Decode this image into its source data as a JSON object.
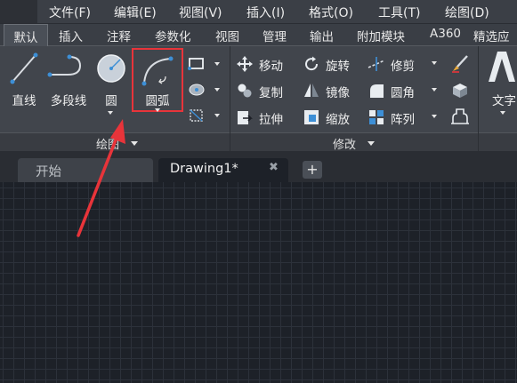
{
  "menubar": {
    "items": [
      "文件(F)",
      "编辑(E)",
      "视图(V)",
      "插入(I)",
      "格式(O)",
      "工具(T)",
      "绘图(D)"
    ]
  },
  "ribbon_tabs": [
    "默认",
    "插入",
    "注释",
    "参数化",
    "视图",
    "管理",
    "输出",
    "附加模块",
    "A360",
    "精选应"
  ],
  "draw_panel": {
    "title": "绘图",
    "tools": {
      "line": "直线",
      "polyline": "多段线",
      "circle": "圆",
      "arc": "圆弧"
    }
  },
  "modify_panel": {
    "title": "修改",
    "tools": {
      "move": "移动",
      "rotate": "旋转",
      "trim": "修剪",
      "copy": "复制",
      "mirror": "镜像",
      "fillet": "圆角",
      "stretch": "拉伸",
      "scale": "缩放",
      "array": "阵列"
    }
  },
  "annotation_panel": {
    "text": "文字"
  },
  "doc_tabs": {
    "start": "开始",
    "drawing": "Drawing1*",
    "new_tab": "+"
  },
  "colors": {
    "highlight": "#e8343a",
    "accent_blue": "#3d8fd6"
  }
}
